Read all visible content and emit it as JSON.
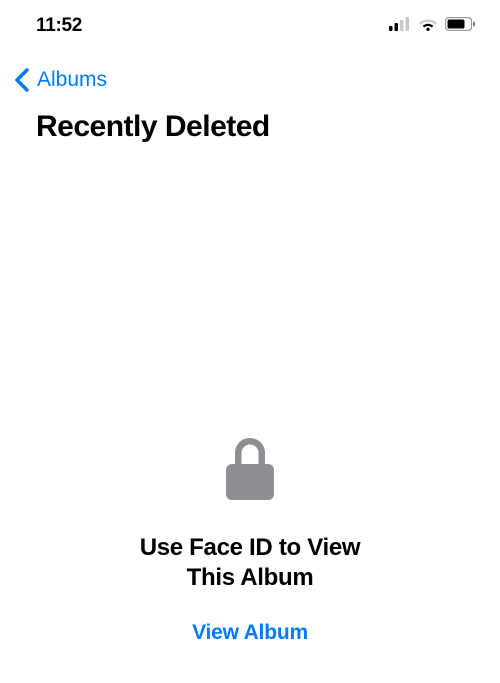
{
  "status_bar": {
    "time": "11:52"
  },
  "nav": {
    "back_label": "Albums"
  },
  "page": {
    "title": "Recently Deleted"
  },
  "locked": {
    "prompt_line1": "Use Face ID to View",
    "prompt_line2": "This Album",
    "action_label": "View Album"
  },
  "colors": {
    "accent": "#007AFF",
    "icon_gray": "#8E8E93"
  }
}
